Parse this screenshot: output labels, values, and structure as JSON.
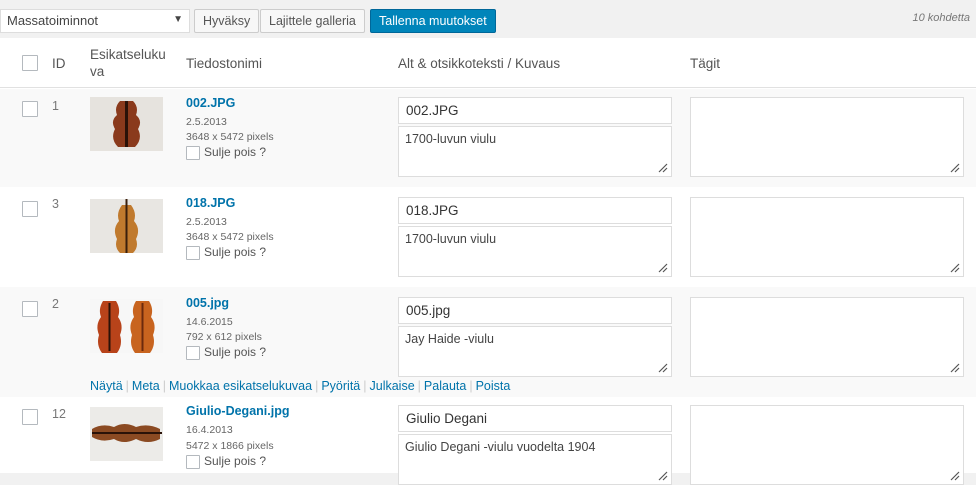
{
  "toolbar": {
    "bulk_actions": "Massatoiminnot",
    "approve": "Hyväksy",
    "sort_gallery": "Lajittele galleria",
    "save_changes": "Tallenna muutokset",
    "item_count": "10 kohdetta",
    "primary_color": "#0085ba"
  },
  "columns": {
    "id": "ID",
    "preview": "Esikatselukuva",
    "filename": "Tiedostonimi",
    "alt": "Alt & otsikkoteksti / Kuvaus",
    "tags": "Tägit"
  },
  "rows": [
    {
      "id": "1",
      "filename": "002.JPG",
      "date": "2.5.2013",
      "dimensions": "3648 x 5472 pixels",
      "exclude": "Sulje pois ?",
      "alt": "002.JPG",
      "description": "1700-luvun viulu",
      "tags": ""
    },
    {
      "id": "3",
      "filename": "018.JPG",
      "date": "2.5.2013",
      "dimensions": "3648 x 5472 pixels",
      "exclude": "Sulje pois ?",
      "alt": "018.JPG",
      "description": "1700-luvun viulu",
      "tags": ""
    },
    {
      "id": "2",
      "filename": "005.jpg",
      "date": "14.6.2015",
      "dimensions": "792 x 612 pixels",
      "exclude": "Sulje pois ?",
      "alt": "005.jpg",
      "description": "Jay Haide -viulu",
      "tags": "",
      "actions": [
        "Näytä",
        "Meta",
        "Muokkaa esikatselukuvaa",
        "Pyöritä",
        "Julkaise",
        "Palauta",
        "Poista"
      ]
    },
    {
      "id": "12",
      "filename": "Giulio-Degani.jpg",
      "date": "16.4.2013",
      "dimensions": "5472 x 1866 pixels",
      "exclude": "Sulje pois ?",
      "alt": "Giulio Degani",
      "description": "Giulio Degani -viulu vuodelta 1904",
      "tags": ""
    }
  ]
}
